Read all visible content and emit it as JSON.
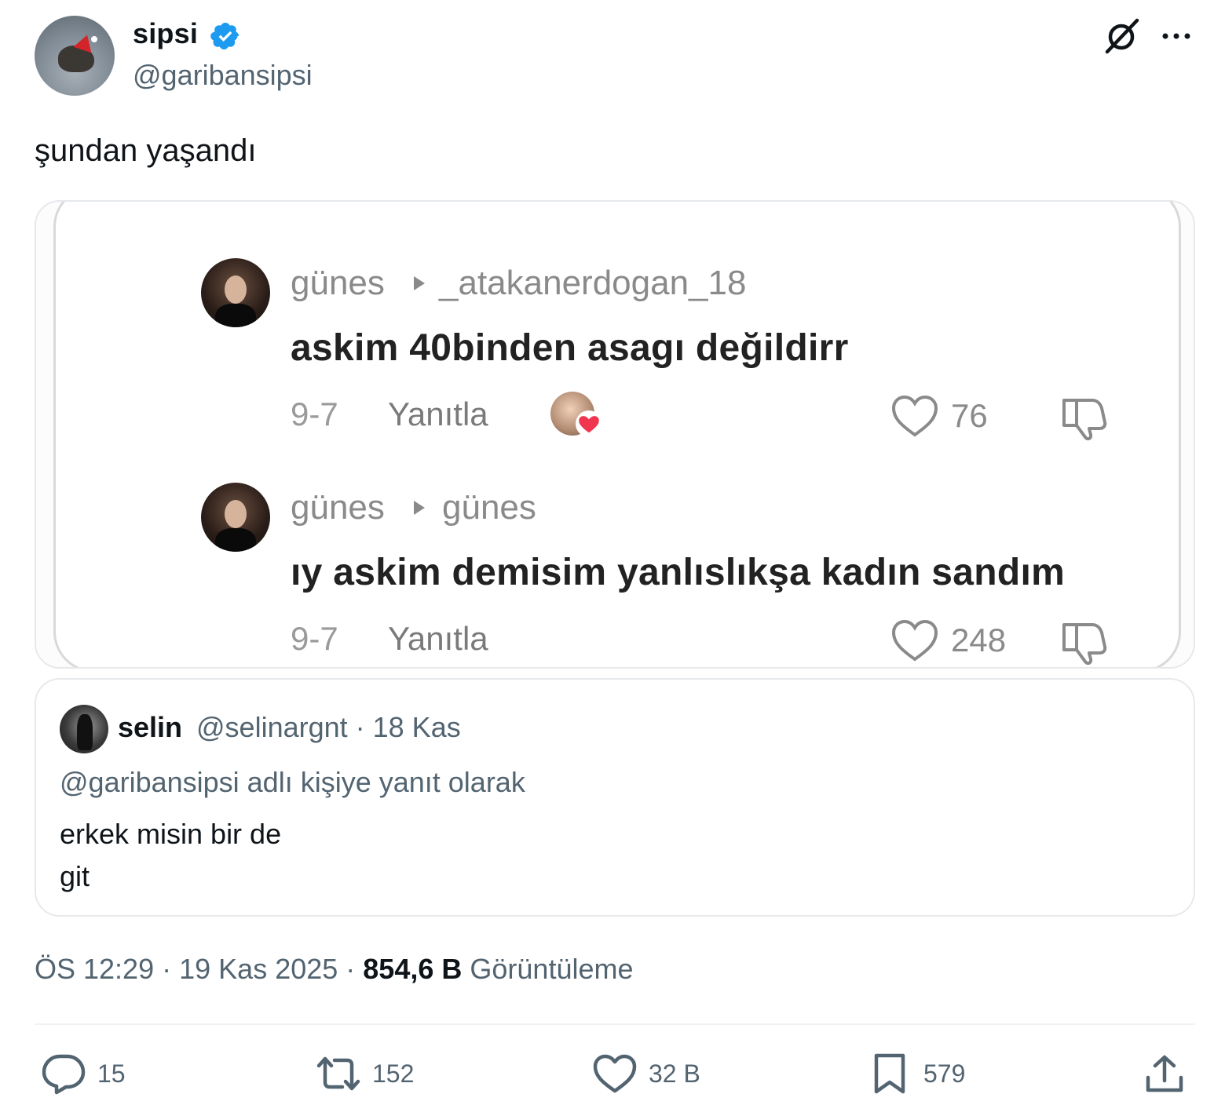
{
  "author": {
    "display_name": "sipsi",
    "handle": "@garibansipsi"
  },
  "tweet": {
    "text": "şundan yaşandı"
  },
  "media": {
    "comments": [
      {
        "user": "günes",
        "reply_to": "_atakanerdogan_18",
        "text": "askim 40binden asagı değildirr",
        "date": "9-7",
        "reply_label": "Yanıtla",
        "likes": "76"
      },
      {
        "user": "günes",
        "reply_to": "günes",
        "text": "ıy askim demisim yanlıslıkşa kadın sandım",
        "date": "9-7",
        "reply_label": "Yanıtla",
        "likes": "248"
      }
    ]
  },
  "quoted": {
    "name": "selin",
    "handle": "@selinargnt",
    "date": "18 Kas",
    "replying_to": "@garibansipsi adlı kişiye yanıt olarak",
    "text_line1": "erkek misin bir de",
    "text_line2": "git"
  },
  "meta": {
    "time": "ÖS 12:29",
    "date": "19 Kas 2025",
    "views_count": "854,6 B",
    "views_label": "Görüntüleme"
  },
  "actions": {
    "replies": "15",
    "reposts": "152",
    "likes": "32 B",
    "bookmarks": "579"
  },
  "icons": {
    "verified": "verified-badge-icon",
    "grok": "grok-icon",
    "more": "more-icon",
    "reply": "reply-icon",
    "repost": "repost-icon",
    "like": "heart-icon",
    "bookmark": "bookmark-icon",
    "share": "share-icon"
  },
  "colors": {
    "verified_blue": "#1d9bf0",
    "secondary_text": "#536471",
    "primary_text": "#0f1419",
    "liker_heart": "#f0364f"
  }
}
